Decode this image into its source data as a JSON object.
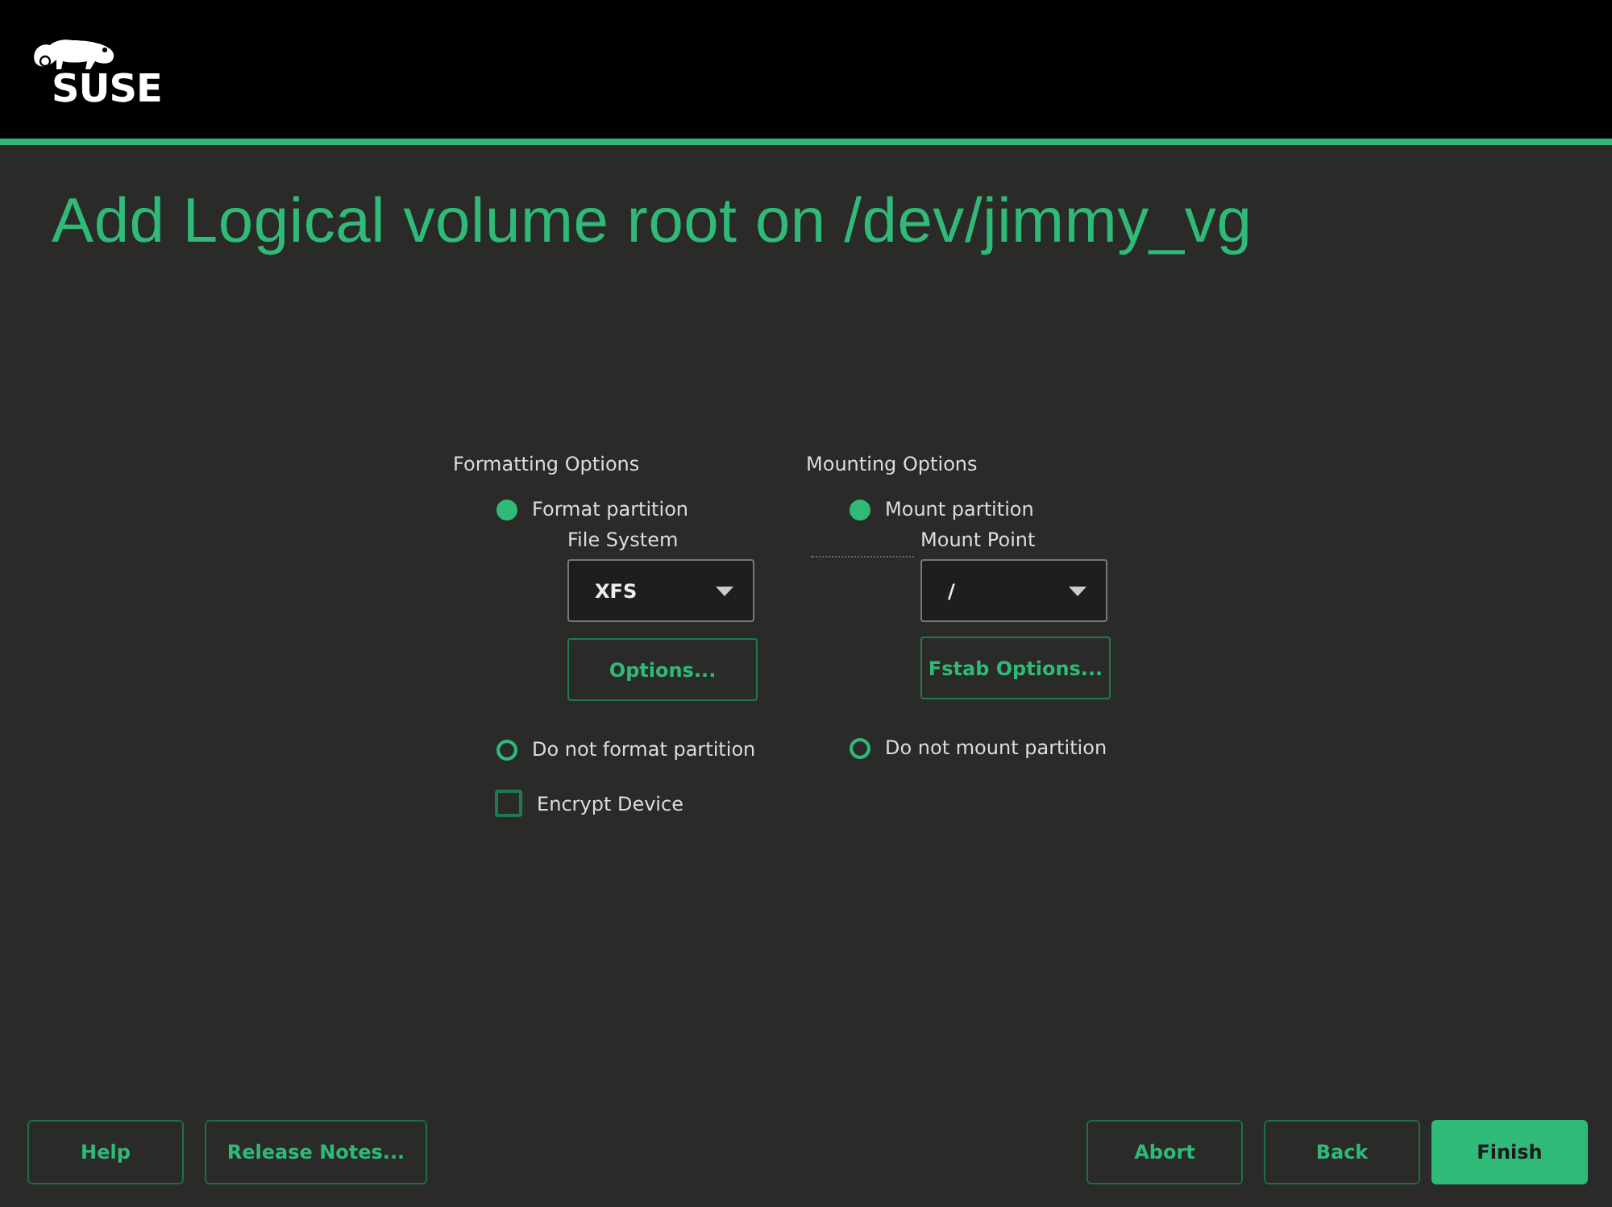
{
  "header": {
    "logo_text": "SUSE"
  },
  "title": "Add Logical volume root on /dev/jimmy_vg",
  "formatting": {
    "heading": "Formatting Options",
    "options": [
      {
        "label": "Format partition",
        "selected": true
      },
      {
        "label": "Do not format partition",
        "selected": false
      }
    ],
    "field_label": "File System",
    "combo_value": "XFS",
    "button": "Options...",
    "encrypt": {
      "label": "Encrypt Device",
      "checked": false
    }
  },
  "mounting": {
    "heading": "Mounting Options",
    "options": [
      {
        "label": "Mount partition",
        "selected": true
      },
      {
        "label": "Do not mount partition",
        "selected": false
      }
    ],
    "field_label": "Mount Point",
    "combo_value": "/",
    "button": "Fstab Options..."
  },
  "buttons_left": [
    {
      "label": "Help",
      "primary": false
    },
    {
      "label": "Release Notes...",
      "primary": false
    }
  ],
  "buttons_right": [
    {
      "label": "Abort",
      "primary": false
    },
    {
      "label": "Back",
      "primary": false
    },
    {
      "label": "Finish",
      "primary": true
    }
  ]
}
